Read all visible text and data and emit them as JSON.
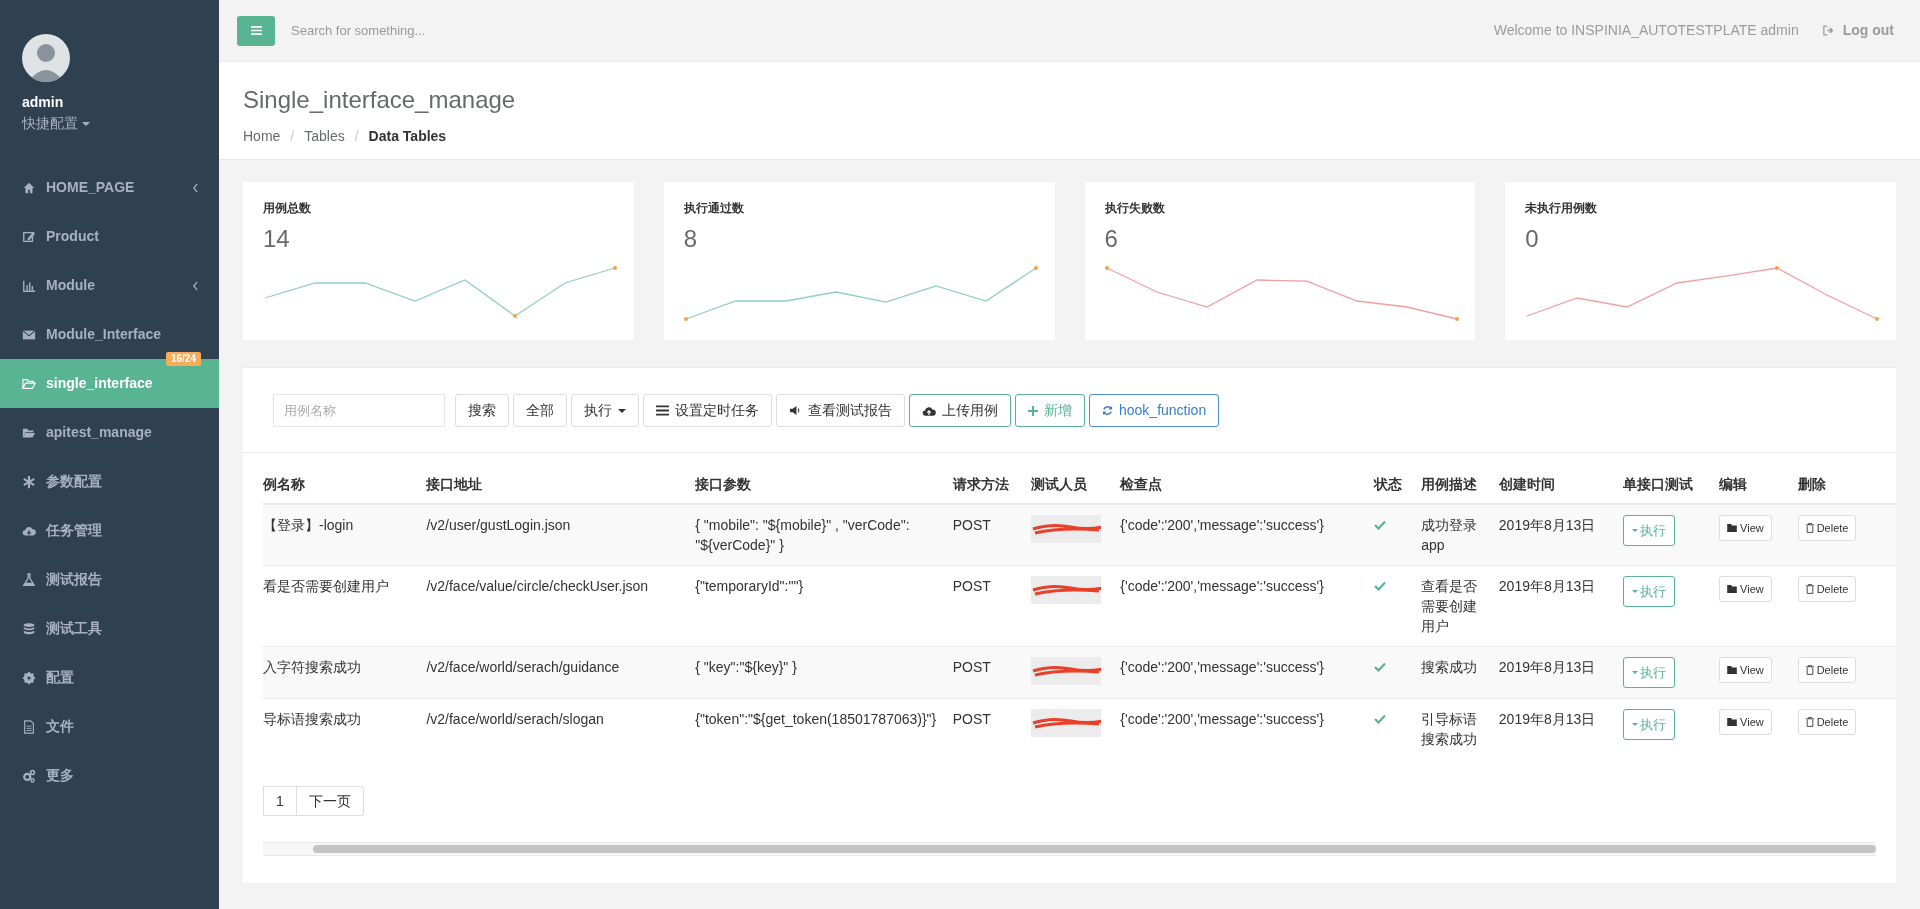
{
  "sidebar": {
    "user": {
      "name": "admin",
      "menu": "快捷配置"
    },
    "items": [
      {
        "label": "HOME_PAGE",
        "expandable": true,
        "selected": false
      },
      {
        "label": "Product",
        "expandable": false,
        "selected": false
      },
      {
        "label": "Module",
        "expandable": true,
        "selected": false
      },
      {
        "label": "Module_Interface",
        "expandable": false,
        "selected": false,
        "badge": "16/24"
      },
      {
        "label": "single_interface",
        "expandable": false,
        "selected": true
      },
      {
        "label": "apitest_manage",
        "expandable": false,
        "selected": false
      },
      {
        "label": "参数配置",
        "expandable": false,
        "selected": false
      },
      {
        "label": "任务管理",
        "expandable": false,
        "selected": false
      },
      {
        "label": "测试报告",
        "expandable": false,
        "selected": false
      },
      {
        "label": "测试工具",
        "expandable": false,
        "selected": false
      },
      {
        "label": "配置",
        "expandable": false,
        "selected": false
      },
      {
        "label": "文件",
        "expandable": false,
        "selected": false
      },
      {
        "label": "更多",
        "expandable": false,
        "selected": false
      }
    ]
  },
  "topbar": {
    "search_placeholder": "Search for something...",
    "welcome": "Welcome to INSPINIA_AUTOTESTPLATE admin",
    "logout": "Log out"
  },
  "page_header": {
    "title": "Single_interface_manage",
    "breadcrumbs": [
      {
        "label": "Home",
        "kind": "link"
      },
      {
        "label": "/",
        "kind": "separator"
      },
      {
        "label": "Tables",
        "kind": "link"
      },
      {
        "label": "/",
        "kind": "separator"
      },
      {
        "label": "Data Tables",
        "kind": "current"
      }
    ]
  },
  "stats": [
    {
      "label": "用例总数",
      "value": "14",
      "color": "#8fd1b9"
    },
    {
      "label": "执行通过数",
      "value": "8",
      "color": "#8fd1b9"
    },
    {
      "label": "执行失败数",
      "value": "6",
      "color": "#f0a0a0"
    },
    {
      "label": "未执行用例数",
      "value": "0",
      "color": "#f0a0a0"
    }
  ],
  "toolbar": {
    "search_placeholder": "用例名称",
    "buttons": [
      {
        "label": "搜索",
        "kind": "plain"
      },
      {
        "label": "全部",
        "kind": "plain"
      },
      {
        "label": "执行",
        "kind": "dropdown"
      },
      {
        "label": "设置定时任务",
        "kind": "schedule"
      },
      {
        "label": "查看测试报告",
        "kind": "report"
      },
      {
        "label": "上传用例",
        "kind": "upload"
      },
      {
        "label": "新增",
        "kind": "add"
      },
      {
        "label": "hook_function",
        "kind": "refresh"
      }
    ]
  },
  "table": {
    "columns": [
      "例名称",
      "接口地址",
      "接口参数",
      "请求方法",
      "测试人员",
      "检查点",
      "状态",
      "用例描述",
      "创建时间",
      "单接口测试",
      "编辑",
      "删除"
    ],
    "rows": [
      {
        "name": "【登录】-login",
        "url": "/v2/user/gustLogin.json",
        "params": "{ \"mobile\": \"${mobile}\" , \"verCode\": \"${verCode}\" }",
        "method": "POST",
        "check": "{'code':'200','message':'success'}",
        "passed": true,
        "description": "成功登录app",
        "created": "2019年8月13日",
        "run": "执行",
        "view": "View",
        "delete": "Delete"
      },
      {
        "name": "看是否需要创建用户",
        "url": "/v2/face/value/circle/checkUser.json",
        "params": "{\"temporaryId\":\"\"}",
        "method": "POST",
        "check": "{'code':'200','message':'success'}",
        "passed": true,
        "description": "查看是否需要创建用户",
        "created": "2019年8月13日",
        "run": "执行",
        "view": "View",
        "delete": "Delete"
      },
      {
        "name": "入字符搜索成功",
        "url": "/v2/face/world/serach/guidance",
        "params": "{ \"key\":\"${key}\" }",
        "method": "POST",
        "check": "{'code':'200','message':'success'}",
        "passed": true,
        "description": "搜索成功",
        "created": "2019年8月13日",
        "run": "执行",
        "view": "View",
        "delete": "Delete"
      },
      {
        "name": "导标语搜索成功",
        "url": "/v2/face/world/serach/slogan",
        "params": "{\"token\":\"${get_token(18501787063)}\"}",
        "method": "POST",
        "check": "{'code':'200','message':'success'}",
        "passed": true,
        "description": "引导标语搜索成功",
        "created": "2019年8月13日",
        "run": "执行",
        "view": "View",
        "delete": "Delete"
      }
    ]
  },
  "pagination": {
    "pages": [
      {
        "label": "1",
        "selected": false
      }
    ],
    "next": "下一页"
  }
}
